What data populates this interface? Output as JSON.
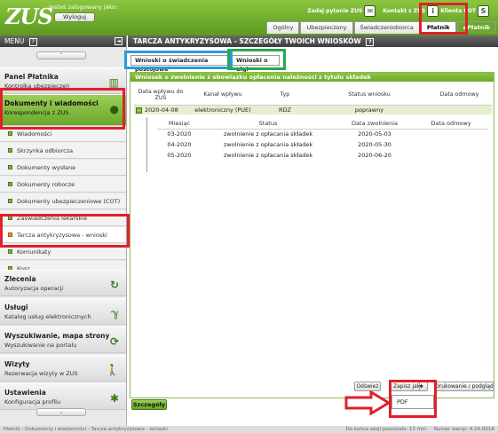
{
  "header": {
    "logo": "ZUS",
    "logged_label": "Jesteś zalogowany jako:",
    "logout": "Wyloguj",
    "ask": "Zadaj pytanie ZUS",
    "contact": "Kontakt z ZUS",
    "cot": "Klienta COT",
    "tabs": [
      "Ogólny",
      "Ubezpieczony",
      "Świadczeniobiorca",
      "Płatnik",
      "ePłatnik"
    ]
  },
  "sidebar": {
    "title": "MENU",
    "help": "?",
    "collapse": "◄",
    "sections": [
      {
        "title": "Panel Płatnika",
        "sub": "Kontrolka ubezpieczeń"
      },
      {
        "title": "Dokumenty i wiadomości",
        "sub": "Korespondencja z ZUS"
      }
    ],
    "items": [
      "Wiadomości",
      "Skrzynka odbiorcza",
      "Dokumenty wysłane",
      "Dokumenty robocze",
      "Dokumenty ubezpieczeniowe (COT)",
      "Zaświadczenia lekarskie",
      "Tarcza antykryzysowa - wnioski",
      "Komunikaty",
      "Kosz"
    ],
    "bottom": [
      {
        "title": "Zlecenia",
        "sub": "Autoryzacja operacji"
      },
      {
        "title": "Usługi",
        "sub": "Katalog usług elektronicznych"
      },
      {
        "title": "Wyszukiwanie, mapa strony",
        "sub": "Wyszukiwanie na portalu"
      },
      {
        "title": "Wizyty",
        "sub": "Rezerwacja wizyty w ZUS"
      },
      {
        "title": "Ustawienia",
        "sub": "Konfiguracja profilu"
      }
    ]
  },
  "main": {
    "title": "TARCZA ANTYKRYZYSOWA - SZCZEGÓŁY TWOICH WNIOSKÓW",
    "help": "?",
    "subtabs": [
      "Wnioski o świadczenia postojowe",
      "Wnioski o ulgi"
    ],
    "panel_title": "Wniosek o zwolnienie z obowiązku opłacenia należności z tytułu składek",
    "cols": [
      "Data wpływu do ZUS",
      "Kanał wpływu",
      "Typ",
      "Status wniosku",
      "Data odmowy"
    ],
    "row": {
      "date": "2020-04-08",
      "channel": "elektroniczny (PUE)",
      "type": "RDZ",
      "status": "poprawny",
      "refusal": ""
    },
    "sub_cols": [
      "Miesiąc",
      "Status",
      "Data zwolnienia",
      "Data odmowy"
    ],
    "sub_rows": [
      {
        "m": "03-2020",
        "s": "zwolnienie z opłacania składek",
        "d": "2020-05-03",
        "r": ""
      },
      {
        "m": "04-2020",
        "s": "zwolnienie z opłacania składek",
        "d": "2020-05-30",
        "r": ""
      },
      {
        "m": "05-2020",
        "s": "zwolnienie z opłacania składek",
        "d": "2020-06-20",
        "r": ""
      }
    ],
    "buttons": {
      "refresh": "Odśwież",
      "save_as": "Zapisz jako",
      "print": "Drukowanie / podgląd",
      "pdf": "PDF",
      "details": "Szczegóły"
    }
  },
  "footer": {
    "path": "Płatnik - Dokumenty i wiadomości - Tarcza antykryzysowa - wnioski",
    "session": "Do końca sesji pozostało: 13 min.",
    "version": "Numer wersji: 4.24.001A"
  },
  "colors": {
    "green": "#8cc63f",
    "red": "#e0202a",
    "blue": "#2a9ad8",
    "frame_green": "#2aa84a"
  }
}
